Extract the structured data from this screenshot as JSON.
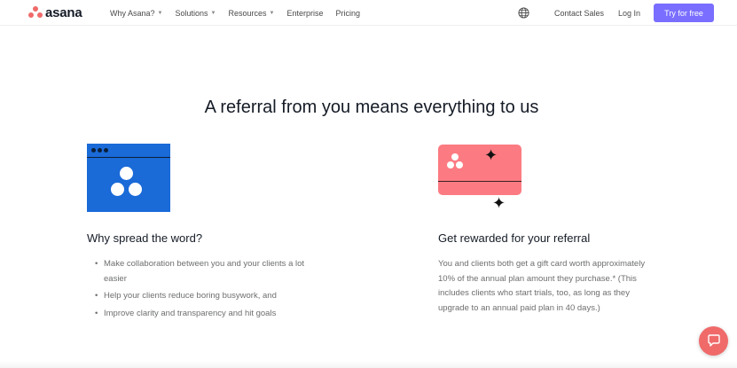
{
  "brand": {
    "name": "asana",
    "color": "#f06a6a"
  },
  "nav": {
    "items": [
      {
        "label": "Why Asana?",
        "has_caret": true
      },
      {
        "label": "Solutions",
        "has_caret": true
      },
      {
        "label": "Resources",
        "has_caret": true
      },
      {
        "label": "Enterprise",
        "has_caret": false
      },
      {
        "label": "Pricing",
        "has_caret": false
      }
    ],
    "globe_icon": "globe-icon",
    "contact_sales": "Contact Sales",
    "login": "Log In",
    "try_free": "Try for free",
    "accent": "#796eff"
  },
  "main": {
    "headline": "A referral from you means everything to us",
    "left": {
      "illustration_color": "#1a6ad8",
      "title": "Why spread the word?",
      "bullets": [
        "Make collaboration between you and your clients a lot easier",
        "Help your clients reduce boring busywork, and",
        "Improve clarity and transparency and hit goals"
      ]
    },
    "right": {
      "illustration_color": "#fc7b82",
      "title": "Get rewarded for your referral",
      "paragraph": "You and clients both get a gift card worth approximately 10% of the annual plan amount they purchase.* (This includes clients who start trials, too, as long as they upgrade to an annual paid plan in 40 days.)"
    }
  },
  "chat_widget": {
    "icon": "chat-bubble-icon",
    "color": "#f06a6a"
  }
}
